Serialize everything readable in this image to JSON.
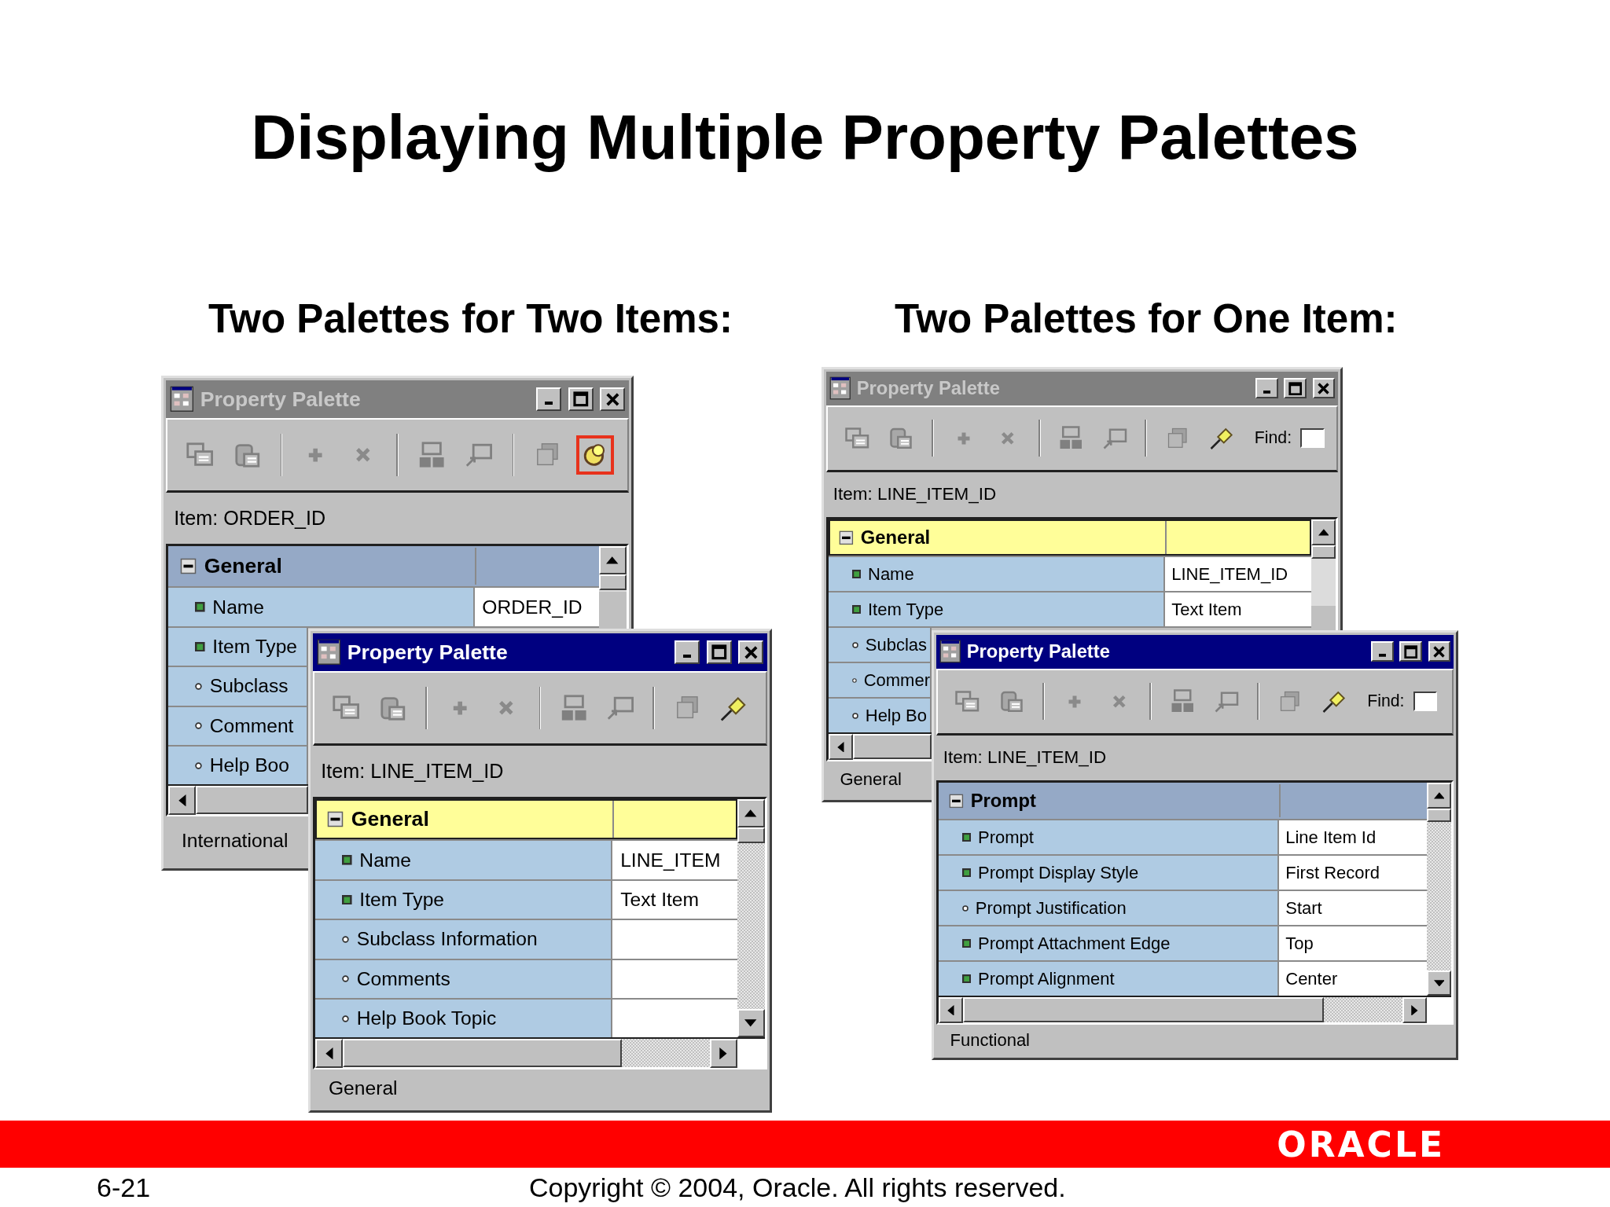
{
  "title": "Displaying Multiple Property Palettes",
  "sections": [
    {
      "heading": "Two Palettes for Two Items:",
      "windows": [
        {
          "title": "Property Palette",
          "active": false,
          "pin": {
            "kind": "freeze",
            "highlighted": true
          },
          "item": "Item: ORDER_ID",
          "group": {
            "label": "General",
            "expanded": true,
            "selected": false
          },
          "rows": [
            {
              "label": "Name",
              "value": "ORDER_ID",
              "kind": "square"
            },
            {
              "label": "Item Type",
              "kind": "square"
            },
            {
              "label": "Subclass",
              "kind": "dot"
            },
            {
              "label": "Comment",
              "kind": "dot"
            },
            {
              "label": "Help Boo",
              "kind": "dot"
            }
          ],
          "status": "International"
        },
        {
          "title": "Property Palette",
          "active": true,
          "pin": {
            "kind": "pin",
            "highlighted": false
          },
          "item": "Item: LINE_ITEM_ID",
          "group": {
            "label": "General",
            "expanded": true,
            "selected": true
          },
          "rows": [
            {
              "label": "Name",
              "value": "LINE_ITEM",
              "kind": "square"
            },
            {
              "label": "Item Type",
              "value": "Text Item",
              "kind": "square"
            },
            {
              "label": "Subclass Information",
              "kind": "dot"
            },
            {
              "label": "Comments",
              "kind": "dot"
            },
            {
              "label": "Help Book Topic",
              "kind": "dot"
            }
          ],
          "status": "General"
        }
      ]
    },
    {
      "heading": "Two Palettes for One Item:",
      "windows": [
        {
          "title": "Property Palette",
          "active": false,
          "pin": {
            "kind": "pin",
            "highlighted": false
          },
          "find": {
            "label": "Find:"
          },
          "item": "Item: LINE_ITEM_ID",
          "group": {
            "label": "General",
            "expanded": true,
            "selected": true
          },
          "rows": [
            {
              "label": "Name",
              "value": "LINE_ITEM_ID",
              "kind": "square"
            },
            {
              "label": "Item Type",
              "value": "Text Item",
              "kind": "square"
            },
            {
              "label": "Subclas",
              "kind": "dot"
            },
            {
              "label": "Commer",
              "kind": "dot"
            },
            {
              "label": "Help Bo",
              "kind": "dot"
            }
          ],
          "status": "General"
        },
        {
          "title": "Property Palette",
          "active": true,
          "pin": {
            "kind": "pin",
            "highlighted": false
          },
          "find": {
            "label": "Find:"
          },
          "item": "Item: LINE_ITEM_ID",
          "group": {
            "label": "Prompt",
            "expanded": true,
            "selected": false
          },
          "rows": [
            {
              "label": "Prompt",
              "value": "Line Item Id",
              "kind": "square"
            },
            {
              "label": "Prompt Display Style",
              "value": "First Record",
              "kind": "square"
            },
            {
              "label": "Prompt Justification",
              "value": "Start",
              "kind": "dot"
            },
            {
              "label": "Prompt Attachment Edge",
              "value": "Top",
              "kind": "square"
            },
            {
              "label": "Prompt Alignment",
              "value": "Center",
              "kind": "square"
            }
          ],
          "status": "Functional"
        }
      ]
    }
  ],
  "logo": "ORACLE",
  "page_number": "6-21",
  "copyright": "Copyright © 2004, Oracle.  All rights reserved."
}
